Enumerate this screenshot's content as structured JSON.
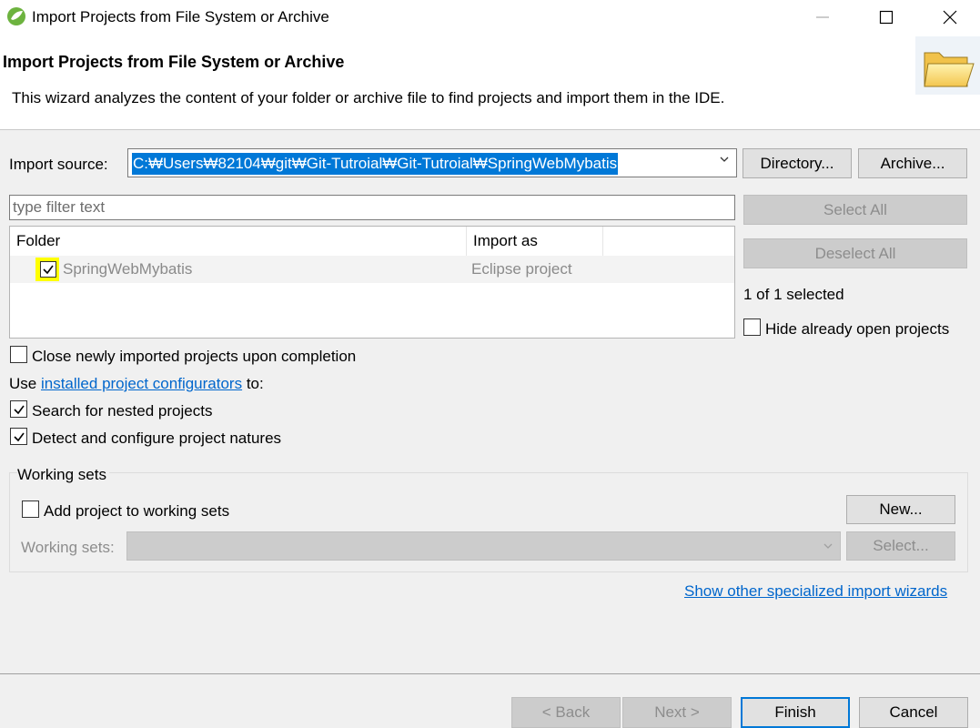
{
  "window": {
    "title": "Import Projects from File System or Archive",
    "controls": {
      "minimize": "—",
      "maximize": "☐",
      "close": "✕"
    }
  },
  "header": {
    "title": "Import Projects from File System or Archive",
    "description": "This wizard analyzes the content of your folder or archive file to find projects and import them in the IDE.",
    "icon": "folder-icon"
  },
  "import_source": {
    "label": "Import source:",
    "value": "C:₩Users₩82104₩git₩Git-Tutroial₩Git-Tutroial₩SpringWebMybatis",
    "directory_button": "Directory...",
    "archive_button": "Archive..."
  },
  "filter": {
    "placeholder": "type filter text"
  },
  "selection_buttons": {
    "select_all": "Select All",
    "deselect_all": "Deselect All"
  },
  "projects_table": {
    "columns": [
      "Folder",
      "Import as"
    ],
    "rows": [
      {
        "folder": "SpringWebMybatis",
        "import_as": "Eclipse project",
        "checked": true
      }
    ]
  },
  "selected_count": "1 of 1 selected",
  "options": {
    "hide_open": {
      "label": "Hide already open projects",
      "checked": false
    },
    "close_newly": {
      "label": "Close newly imported projects upon completion",
      "checked": false
    },
    "use_prefix": "Use",
    "configurators_link": "installed project configurators",
    "use_suffix": "to:",
    "search_nested": {
      "label": "Search for nested projects",
      "checked": true
    },
    "detect_natures": {
      "label": "Detect and configure project natures",
      "checked": true
    }
  },
  "working_sets": {
    "group_label": "Working sets",
    "add_label": "Add project to working sets",
    "add_checked": false,
    "new_button": "New...",
    "sets_label": "Working sets:",
    "select_button": "Select..."
  },
  "other_wizards_link": "Show other specialized import wizards",
  "footer": {
    "back": "< Back",
    "next": "Next >",
    "finish": "Finish",
    "cancel": "Cancel"
  },
  "colors": {
    "selection": "#0078d7",
    "link": "#0066cc",
    "highlight": "#ffff00"
  }
}
